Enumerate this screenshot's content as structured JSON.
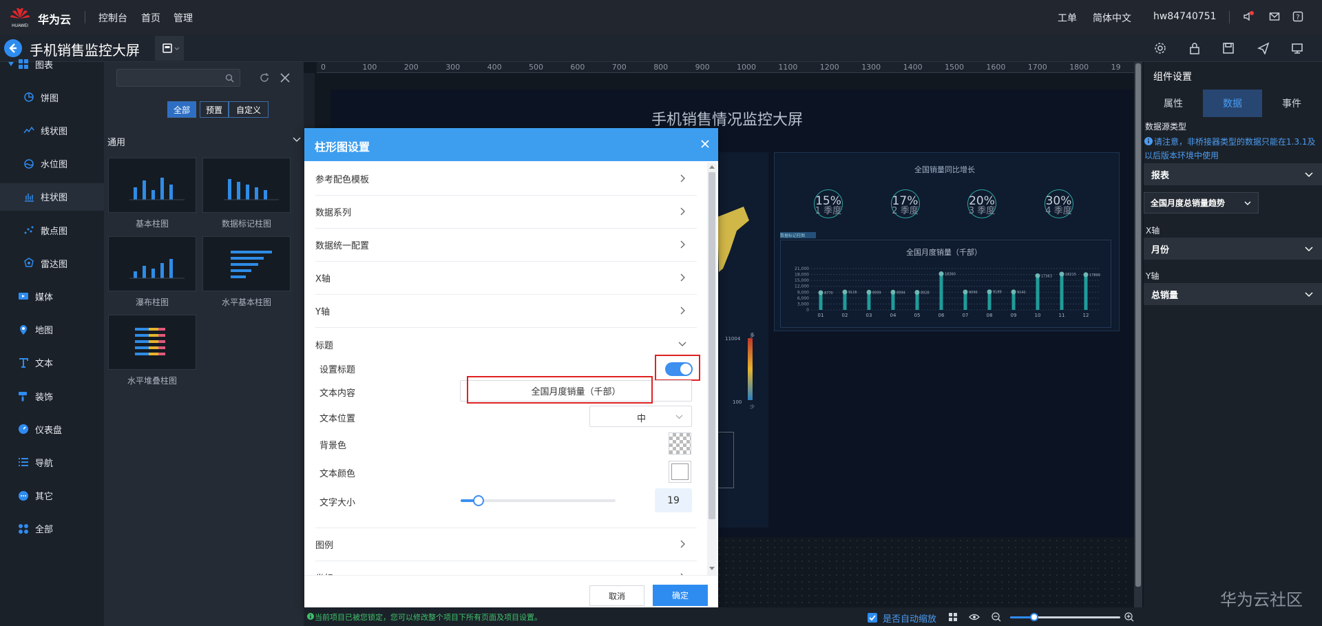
{
  "topbar": {
    "brand": "华为云",
    "logo_text": "HUAWEI",
    "nav": [
      "控制台",
      "首页",
      "管理"
    ],
    "right": {
      "ticket": "工单",
      "language": "简体中文",
      "user": "hw84740751"
    }
  },
  "header": {
    "page_title": "手机销售监控大屏"
  },
  "sidebar": {
    "items": [
      {
        "label": "图表",
        "icon": "grid-icon",
        "level": "top"
      },
      {
        "label": "饼图",
        "icon": "pie-chart-icon",
        "level": "sub"
      },
      {
        "label": "线状图",
        "icon": "line-chart-icon",
        "level": "sub"
      },
      {
        "label": "水位图",
        "icon": "water-level-icon",
        "level": "sub"
      },
      {
        "label": "柱状图",
        "icon": "bar-chart-icon",
        "level": "sub",
        "active": true
      },
      {
        "label": "散点图",
        "icon": "scatter-icon",
        "level": "sub"
      },
      {
        "label": "雷达图",
        "icon": "radar-icon",
        "level": "sub"
      },
      {
        "label": "媒体",
        "icon": "media-icon",
        "level": "top"
      },
      {
        "label": "地图",
        "icon": "map-pin-icon",
        "level": "top"
      },
      {
        "label": "文本",
        "icon": "text-icon",
        "level": "top"
      },
      {
        "label": "装饰",
        "icon": "brush-icon",
        "level": "top"
      },
      {
        "label": "仪表盘",
        "icon": "gauge-icon",
        "level": "top"
      },
      {
        "label": "导航",
        "icon": "list-icon",
        "level": "top"
      },
      {
        "label": "其它",
        "icon": "more-icon",
        "level": "top"
      },
      {
        "label": "全部",
        "icon": "apps-icon",
        "level": "top"
      }
    ]
  },
  "components": {
    "filters": [
      "全部",
      "预置",
      "自定义"
    ],
    "section": "通用",
    "items": [
      "基本柱图",
      "数据标记柱图",
      "瀑布柱图",
      "水平基本柱图",
      "水平堆叠柱图"
    ]
  },
  "ruler": {
    "ticks": [
      "0",
      "100",
      "200",
      "300",
      "400",
      "500",
      "600",
      "700",
      "800",
      "900",
      "1000",
      "1100",
      "1200",
      "1300",
      "1400",
      "1500",
      "1600",
      "1700",
      "1800",
      "19"
    ]
  },
  "screen": {
    "title": "手机销售情况监控大屏",
    "growth_title": "全国销量同比增长",
    "quarters": [
      {
        "pct": "15%",
        "label": "1 季度"
      },
      {
        "pct": "17%",
        "label": "2 季度"
      },
      {
        "pct": "20%",
        "label": "3 季度"
      },
      {
        "pct": "30%",
        "label": "4 季度"
      }
    ],
    "chart_tag": "数据标记柱图",
    "legend_scale": {
      "max": "11004",
      "min": "100",
      "high": "多",
      "low": "少"
    }
  },
  "chart_data": {
    "type": "bar",
    "title": "全国月度销量（千部）",
    "categories": [
      "01",
      "02",
      "03",
      "04",
      "05",
      "06",
      "07",
      "08",
      "09",
      "10",
      "11",
      "12"
    ],
    "values": [
      8770,
      9116,
      8999,
      8994,
      8928,
      18360,
      9090,
      9189,
      9142,
      17363,
      18215,
      17899
    ],
    "ylim": [
      0,
      21000
    ],
    "yticks": [
      "21,000",
      "18,000",
      "15,000",
      "12,000",
      "9,000",
      "6,000",
      "3,000",
      "0"
    ]
  },
  "dialog": {
    "title": "柱形图设置",
    "sections": [
      "参考配色模板",
      "数据系列",
      "数据统一配置",
      "X轴",
      "Y轴",
      "标题"
    ],
    "title_fields": {
      "set_title": "设置标题",
      "text_content": "文本内容",
      "text_value": "全国月度销量（千部）",
      "text_position": "文本位置",
      "position_value": "中",
      "bg_color": "背景色",
      "text_color": "文本颜色",
      "font_size": "文字大小",
      "font_size_value": "19",
      "toggle_on": true
    },
    "after_sections": [
      "图例",
      "坐标"
    ],
    "cancel": "取消",
    "ok": "确定"
  },
  "statusbar": {
    "message": "当前项目已被您锁定，您可以修改整个项目下所有页面及项目设置。",
    "auto_scale": "是否自动缩放"
  },
  "right_panel": {
    "title": "组件设置",
    "tabs": [
      "属性",
      "数据",
      "事件"
    ],
    "active_tab": "数据",
    "datasource_label": "数据源类型",
    "note": "请注意，非桥接器类型的数据只能在1.3.1及以后版本环境中使用",
    "datasource_value": "报表",
    "report_value": "全国月度总销量趋势",
    "x_label": "X轴",
    "x_value": "月份",
    "y_label": "Y轴",
    "y_value": "总销量"
  },
  "watermark": "华为云社区",
  "colors": {
    "accent": "#2e8cf0",
    "dialog_header": "#3d9ef0",
    "highlight": "#e02020",
    "bar": "#1f9c9a"
  }
}
